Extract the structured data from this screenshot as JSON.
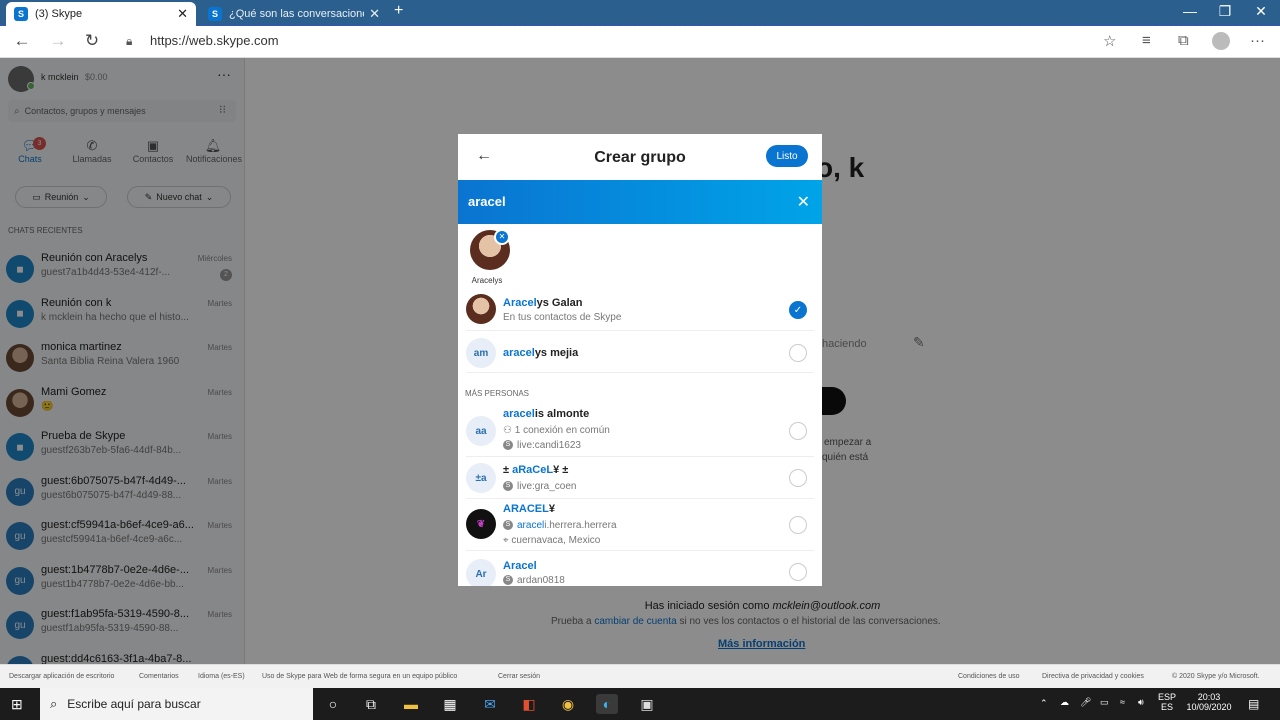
{
  "browser": {
    "tabs": [
      {
        "title": "(3) Skype",
        "icon": "skype-icon"
      },
      {
        "title": "¿Qué son las conversaciones pri",
        "icon": "skype-icon"
      }
    ],
    "new_tab": "+",
    "url": "https://web.skype.com"
  },
  "profile": {
    "name": "k mcklein",
    "credit": "$0.00"
  },
  "search": {
    "placeholder": "Contactos, grupos y mensajes"
  },
  "nav": [
    {
      "label": "Chats",
      "badge": "3",
      "icon": "chat-icon"
    },
    {
      "label": "Llamadas",
      "icon": "phone-icon"
    },
    {
      "label": "Contactos",
      "icon": "contacts-icon"
    },
    {
      "label": "Notificaciones",
      "icon": "bell-icon"
    }
  ],
  "actions": {
    "meeting": "Reunión",
    "new_chat": "Nuevo chat"
  },
  "recent_header": "CHATS RECIENTES",
  "chats": [
    {
      "avatar": "video",
      "name": "Reunión con Aracelys",
      "sub": "guest7a1b4d43-53e4-412f-...",
      "day": "Miércoles",
      "badge": "2"
    },
    {
      "avatar": "video",
      "name": "Reunión con k",
      "sub": "k mcklein ha hecho que el histo...",
      "day": "Martes"
    },
    {
      "avatar": "photo",
      "name": "monica martinez",
      "sub": "Santa Biblia Reina Valera 1960",
      "day": "Martes"
    },
    {
      "avatar": "photo",
      "name": "Mami Gomez",
      "sub": "🙂",
      "day": "Martes"
    },
    {
      "avatar": "video",
      "name": "Prueba de Skype",
      "sub": "guestf263b7eb-5fa6-44df-84b...",
      "day": "Martes"
    },
    {
      "avatar": "gu",
      "name": "guest:6b075075-b47f-4d49-...",
      "sub": "guest6b075075-b47f-4d49-88...",
      "day": "Martes"
    },
    {
      "avatar": "gu",
      "name": "guest:cf59941a-b6ef-4ce9-a6...",
      "sub": "guestcf59941a-b6ef-4ce9-a6c...",
      "day": "Martes"
    },
    {
      "avatar": "gu",
      "name": "guest:1b4778b7-0e2e-4d6e-...",
      "sub": "guest1b4778b7-0e2e-4d6e-bb...",
      "day": "Martes"
    },
    {
      "avatar": "gu",
      "name": "guest:f1ab95fa-5319-4590-8...",
      "sub": "guestf1ab95fa-5319-4590-88...",
      "day": "Martes"
    },
    {
      "avatar": "gu",
      "name": "guest:dd4c6163-3f1a-4ba7-8...",
      "sub": "",
      "day": ""
    }
  ],
  "background": {
    "greeting": "o, k",
    "status_placeholder": "haciendo",
    "hint1": "empezar a",
    "hint2": "quién está",
    "signed_in": "Has iniciado sesión como",
    "email": "mcklein@outlook.com",
    "switch_pre": "Prueba a",
    "switch_link": "cambiar de cuenta",
    "switch_post": "si no ves los contactos o el historial de las conversaciones.",
    "more_info": "Más información"
  },
  "modal": {
    "title": "Crear grupo",
    "done": "Listo",
    "query": "aracel",
    "selected_name": "Aracelys",
    "section_more": "MÁS PERSONAS",
    "results": [
      {
        "initials": "",
        "match": "Aracel",
        "rest": "ys Galan",
        "sub1": "En tus contactos de Skype",
        "sub2": "",
        "checked": true
      },
      {
        "initials": "am",
        "match": "aracel",
        "rest": "ys mejia",
        "sub1": "",
        "sub2": "",
        "checked": false
      }
    ],
    "more": [
      {
        "initials": "aa",
        "match": "aracel",
        "rest": "is almonte",
        "sub1": "1 conexión en común",
        "sub2": "live:candi1623"
      },
      {
        "initials": "±a",
        "pre": "± ",
        "match": "aRaCeL",
        "rest": "¥ ±",
        "sub1": "live:gra_coen",
        "sub2": ""
      },
      {
        "initials": "",
        "match": "ARACEL",
        "rest": "¥",
        "sub1_match": "aracel",
        "sub1": "i.herrera.herrera",
        "sub2": "cuernavaca, Mexico"
      },
      {
        "initials": "Ar",
        "match": "Aracel",
        "rest": "",
        "sub1": "ardan0818",
        "sub2": ""
      }
    ]
  },
  "footer": {
    "left": [
      "Descargar aplicación de escritorio",
      "Comentarios",
      "Idioma (es-ES)",
      "Uso de Skype para Web de forma segura en un equipo público",
      "Cerrar sesión"
    ],
    "right": [
      "Condiciones de uso",
      "Directiva de privacidad y cookies",
      "© 2020 Skype y/o Microsoft."
    ]
  },
  "taskbar": {
    "search": "Escribe aquí para buscar",
    "lang1": "ESP",
    "lang2": "ES",
    "time": "20:03",
    "date": "10/09/2020"
  },
  "colors": {
    "accent": "#0a74d1",
    "tabbar": "#2b5f8e"
  }
}
